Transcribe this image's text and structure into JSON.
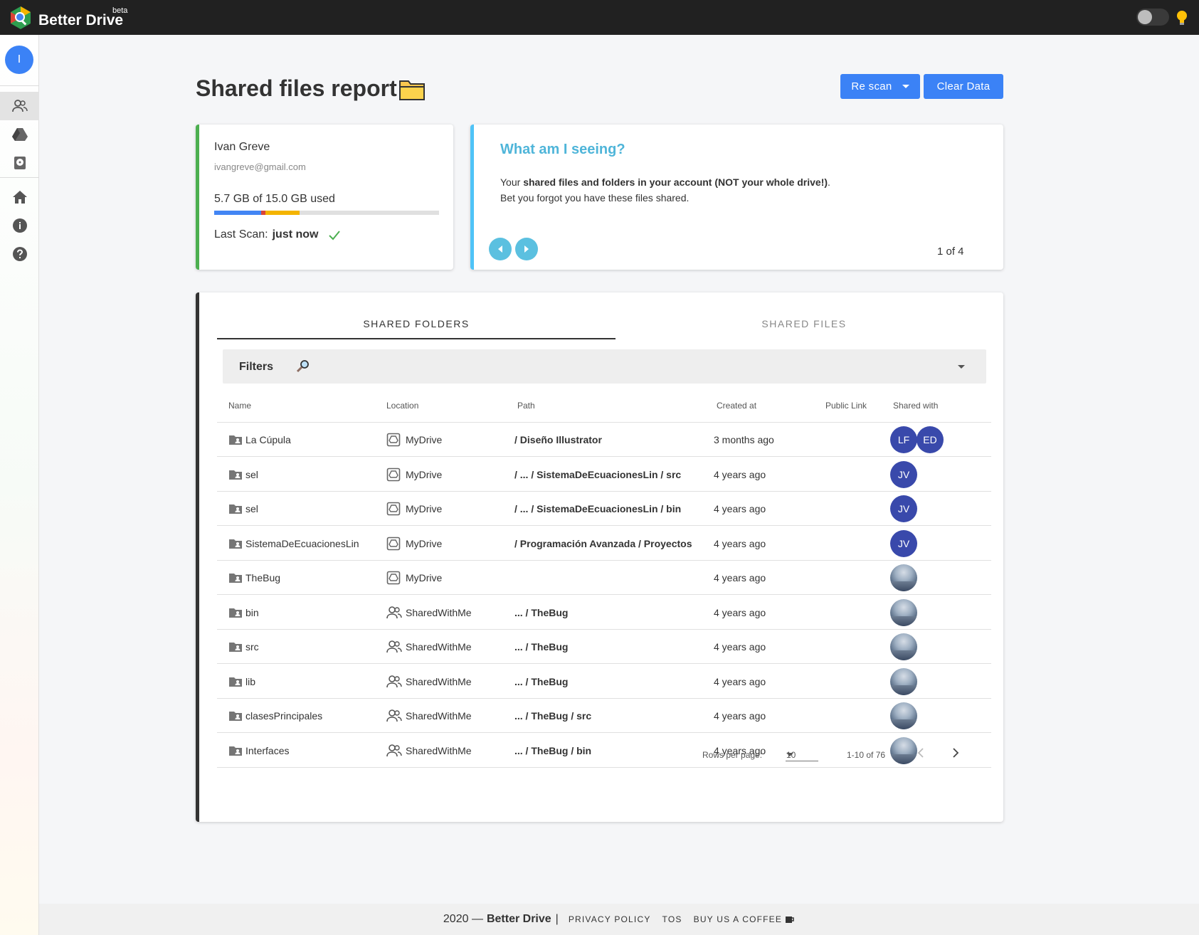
{
  "app": {
    "brand": "Better Drive",
    "badge": "beta"
  },
  "sidebar": {
    "avatar_initial": "I"
  },
  "header": {
    "title": "Shared files report",
    "rescan_label": "Re scan",
    "clear_label": "Clear Data"
  },
  "user_card": {
    "name": "Ivan Greve",
    "email": "ivangreve@gmail.com",
    "usage": "5.7 GB of 15.0 GB used",
    "usage_fraction": 0.38,
    "last_scan_label": "Last Scan:",
    "last_scan_value": "just now"
  },
  "info_card": {
    "title": "What am I seeing?",
    "line1_prefix": "Your ",
    "line1_bold": "shared files and folders in your account (NOT your whole drive!)",
    "line1_suffix": ".",
    "line2": "Bet you forgot you have these files shared.",
    "counter": "1 of 4"
  },
  "tabs": {
    "folders": "Shared Folders",
    "files": "Shared Files"
  },
  "filters": {
    "label": "Filters"
  },
  "table": {
    "columns": {
      "name": "Name",
      "location": "Location",
      "path": "Path",
      "created": "Created at",
      "public_link": "Public Link",
      "shared_with": "Shared with"
    },
    "rows": [
      {
        "name": "La Cúpula",
        "location": "MyDrive",
        "path": "/ Diseño Illustrator",
        "created": "3 months ago",
        "shared": "LF,ED"
      },
      {
        "name": "sel",
        "location": "MyDrive",
        "path": "/ ... / SistemaDeEcuacionesLin / src",
        "created": "4 years ago",
        "shared": "JV"
      },
      {
        "name": "sel",
        "location": "MyDrive",
        "path": "/ ... / SistemaDeEcuacionesLin / bin",
        "created": "4 years ago",
        "shared": "JV"
      },
      {
        "name": "SistemaDeEcuacionesLin",
        "location": "MyDrive",
        "path": "/ Programación Avanzada / Proyectos",
        "created": "4 years ago",
        "shared": "JV"
      },
      {
        "name": "TheBug",
        "location": "MyDrive",
        "path": "",
        "created": "4 years ago",
        "shared": "photo"
      },
      {
        "name": "bin",
        "location": "SharedWithMe",
        "path": "... / TheBug",
        "created": "4 years ago",
        "shared": "photo"
      },
      {
        "name": "src",
        "location": "SharedWithMe",
        "path": "... / TheBug",
        "created": "4 years ago",
        "shared": "photo"
      },
      {
        "name": "lib",
        "location": "SharedWithMe",
        "path": "... / TheBug",
        "created": "4 years ago",
        "shared": "photo"
      },
      {
        "name": "clasesPrincipales",
        "location": "SharedWithMe",
        "path": "... / TheBug / src",
        "created": "4 years ago",
        "shared": "photo"
      },
      {
        "name": "Interfaces",
        "location": "SharedWithMe",
        "path": "... / TheBug / bin",
        "created": "4 years ago",
        "shared": "photo"
      }
    ]
  },
  "pagination": {
    "rows_label": "Rows per page:",
    "rows_value": "10",
    "range": "1-10 of 76"
  },
  "footer": {
    "year": "2020 —",
    "brand": "Better Drive",
    "separator": "|",
    "privacy": "Privacy Policy",
    "tos": "TOS",
    "coffee": "Buy us a coffee"
  }
}
